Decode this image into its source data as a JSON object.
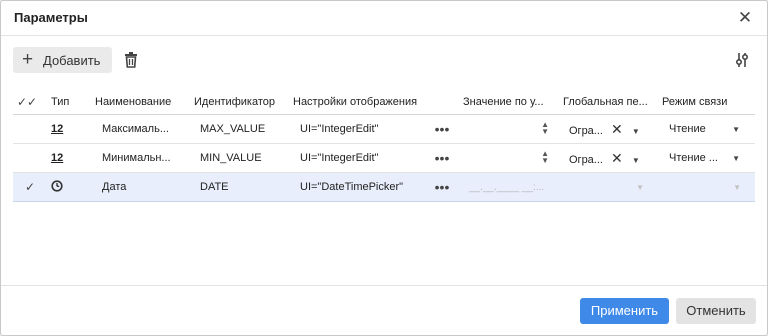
{
  "dialog": {
    "title": "Параметры",
    "close_icon": "close-icon"
  },
  "toolbar": {
    "add_label": "Добавить",
    "add_icon": "plus-icon",
    "delete_icon": "trash-icon",
    "settings_icon": "column-settings-icon"
  },
  "table": {
    "columns": {
      "check": "",
      "type": "Тип",
      "name": "Наименование",
      "id": "Идентификатор",
      "display": "Настройки отображения",
      "default": "Значение по у...",
      "global": "Глобальная пе...",
      "mode": "Режим связи"
    },
    "rows": [
      {
        "selected": false,
        "type": "12",
        "name": "Максималь...",
        "id": "MAX_VALUE",
        "display": "UI=\"IntegerEdit\"",
        "default": "",
        "global": "Огра...",
        "mode": "Чтение"
      },
      {
        "selected": false,
        "type": "12",
        "name": "Минимальн...",
        "id": "MIN_VALUE",
        "display": "UI=\"IntegerEdit\"",
        "default": "",
        "global": "Огра...",
        "mode": "Чтение ..."
      },
      {
        "selected": true,
        "type": "clock-icon",
        "name": "Дата",
        "id": "DATE",
        "display": "UI=\"DateTimePicker\"",
        "default": "__.__.____ __:...",
        "global": "",
        "mode": ""
      }
    ]
  },
  "footer": {
    "apply_label": "Применить",
    "cancel_label": "Отменить"
  },
  "colors": {
    "accent": "#3f8ae8",
    "selected_row": "#e8eefb"
  }
}
